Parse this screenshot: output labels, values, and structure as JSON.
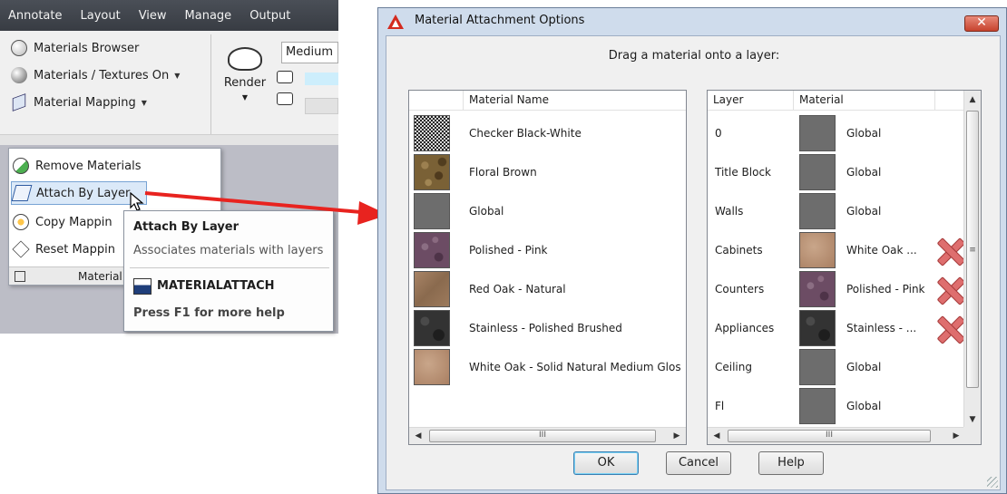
{
  "ribbon": {
    "tabs": [
      "Annotate",
      "Layout",
      "View",
      "Manage",
      "Output"
    ],
    "buttons": [
      {
        "label": "Materials Browser",
        "icon": "materials-browser-icon",
        "has_menu": false
      },
      {
        "label": "Materials / Textures On",
        "icon": "materials-sphere-icon",
        "has_menu": true
      },
      {
        "label": "Material Mapping",
        "icon": "material-mapping-icon",
        "has_menu": true
      }
    ],
    "render_label": "Render",
    "render_quality_value": "Medium"
  },
  "dropdown": {
    "items": [
      {
        "label": "Remove Materials",
        "icon": "remove-materials-icon"
      },
      {
        "label": "Attach By Layer",
        "icon": "attach-by-layer-icon",
        "highlighted": true
      },
      {
        "label": "Copy Mappin",
        "icon": "copy-mapping-icon"
      },
      {
        "label": "Reset Mappin",
        "icon": "reset-mapping-icon"
      }
    ],
    "footer_label": "Material"
  },
  "tooltip": {
    "title": "Attach By Layer",
    "description": "Associates materials with layers",
    "command": "MATERIALATTACH",
    "help": "Press F1 for more help"
  },
  "dialog": {
    "title": "Material Attachment Options",
    "close_glyph": "✕",
    "instruction": "Drag a material onto a layer:",
    "materials_header": "Material Name",
    "materials": [
      {
        "name": "Checker Black-White",
        "texture": "checker"
      },
      {
        "name": "Floral Brown",
        "texture": "floral"
      },
      {
        "name": "Global",
        "texture": "global"
      },
      {
        "name": "Polished - Pink",
        "texture": "pink"
      },
      {
        "name": "Red Oak - Natural",
        "texture": "redoak"
      },
      {
        "name": "Stainless - Polished Brushed",
        "texture": "steel"
      },
      {
        "name": "White Oak - Solid Natural Medium Glos",
        "texture": "whiteoak"
      }
    ],
    "layers_header": {
      "layer": "Layer",
      "material": "Material"
    },
    "layers": [
      {
        "layer": "0",
        "material": "Global",
        "texture": "global",
        "removable": false
      },
      {
        "layer": "Title Block",
        "material": "Global",
        "texture": "global",
        "removable": false
      },
      {
        "layer": "Walls",
        "material": "Global",
        "texture": "global",
        "removable": false
      },
      {
        "layer": "Cabinets",
        "material": "White Oak ...",
        "texture": "whiteoak",
        "removable": true
      },
      {
        "layer": "Counters",
        "material": "Polished - Pink",
        "texture": "pink",
        "removable": true
      },
      {
        "layer": "Appliances",
        "material": "Stainless - ...",
        "texture": "steel",
        "removable": true
      },
      {
        "layer": "Ceiling",
        "material": "Global",
        "texture": "global",
        "removable": false
      },
      {
        "layer": "Fl",
        "material": "Global",
        "texture": "global",
        "removable": false
      }
    ],
    "scroll_grip": "III",
    "buttons": {
      "ok": "OK",
      "cancel": "Cancel",
      "help": "Help"
    }
  },
  "colors": {
    "arrow": "#e8231f",
    "highlight": "#dbe9f8",
    "remove_x": "#de6e6e"
  }
}
